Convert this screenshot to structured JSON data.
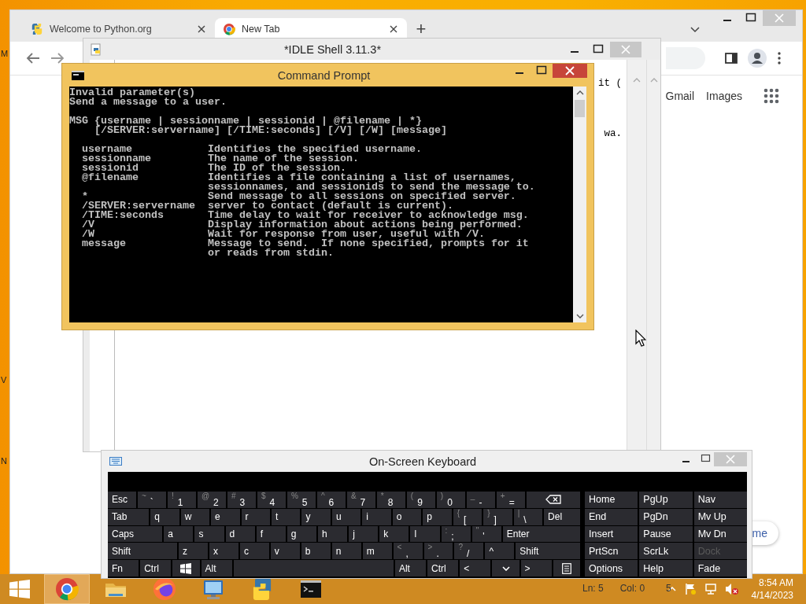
{
  "desktop": {
    "icon_labels": [
      "M",
      "V",
      "N"
    ]
  },
  "browser": {
    "tabs": [
      {
        "title": "Welcome to Python.org",
        "kind": "python",
        "selected": false
      },
      {
        "title": "New Tab",
        "kind": "chrome",
        "selected": true
      }
    ],
    "new_tab_label": "+",
    "header_links": [
      "Gmail",
      "Images"
    ],
    "corner_button": "me"
  },
  "idle": {
    "title": "*IDLE Shell 3.11.3*",
    "visible_text": [
      "it (",
      "wa."
    ],
    "status": [
      "Ln: 5",
      "Col: 0",
      "5"
    ]
  },
  "console": {
    "title": "Command Prompt",
    "blocks": [
      [
        "Invalid parameter(s)",
        "Send a message to a user."
      ],
      [
        "MSG {username | sessionname | sessionid | @filename | *}",
        "    [/SERVER:servername] [/TIME:seconds] [/V] [/W] [message]"
      ],
      [
        "  username            Identifies the specified username.",
        "  sessionname         The name of the session.",
        "  sessionid           The ID of the session.",
        "  @filename           Identifies a file containing a list of usernames,",
        "                      sessionnames, and sessionids to send the message to.",
        "  *                   Send message to all sessions on specified server.",
        "  /SERVER:servername  server to contact (default is current).",
        "  /TIME:seconds       Time delay to wait for receiver to acknowledge msg.",
        "  /V                  Display information about actions being performed.",
        "  /W                  Wait for response from user, useful with /V.",
        "  message             Message to send.  If none specified, prompts for it",
        "                      or reads from stdin."
      ]
    ]
  },
  "keyboard": {
    "title": "On-Screen Keyboard",
    "key_lines": [
      {
        "keys": [
          {
            "kind": "key",
            "label": "Esc"
          },
          {
            "kind": "key",
            "label": "`",
            "shift": "~"
          },
          {
            "kind": "key",
            "label": "1",
            "shift": "!"
          },
          {
            "kind": "key",
            "label": "2",
            "shift": "@"
          },
          {
            "kind": "key",
            "label": "3",
            "shift": "#"
          },
          {
            "kind": "key",
            "label": "4",
            "shift": "$"
          },
          {
            "kind": "key",
            "label": "5",
            "shift": "%"
          },
          {
            "kind": "key",
            "label": "6",
            "shift": "^"
          },
          {
            "kind": "key",
            "label": "7",
            "shift": "&"
          },
          {
            "kind": "key",
            "label": "8",
            "shift": "*"
          },
          {
            "kind": "key",
            "label": "9",
            "shift": "("
          },
          {
            "kind": "key",
            "label": "0",
            "shift": ")"
          },
          {
            "kind": "key",
            "label": "-",
            "shift": "_"
          },
          {
            "kind": "key",
            "label": "=",
            "shift": "+"
          },
          {
            "kind": "backspace"
          }
        ]
      },
      {
        "keys": [
          {
            "kind": "key",
            "label": "Tab"
          },
          {
            "kind": "key",
            "label": "q"
          },
          {
            "kind": "key",
            "label": "w"
          },
          {
            "kind": "key",
            "label": "e"
          },
          {
            "kind": "key",
            "label": "r"
          },
          {
            "kind": "key",
            "label": "t"
          },
          {
            "kind": "key",
            "label": "y"
          },
          {
            "kind": "key",
            "label": "u"
          },
          {
            "kind": "key",
            "label": "i"
          },
          {
            "kind": "key",
            "label": "o"
          },
          {
            "kind": "key",
            "label": "p"
          },
          {
            "kind": "key",
            "label": "[",
            "shift": "{"
          },
          {
            "kind": "key",
            "label": "]",
            "shift": "}"
          },
          {
            "kind": "key",
            "label": "\\",
            "shift": "|"
          },
          {
            "kind": "key",
            "label": "Del"
          }
        ]
      },
      {
        "keys": [
          {
            "kind": "key",
            "label": "Caps"
          },
          {
            "kind": "key",
            "label": "a"
          },
          {
            "kind": "key",
            "label": "s"
          },
          {
            "kind": "key",
            "label": "d"
          },
          {
            "kind": "key",
            "label": "f"
          },
          {
            "kind": "key",
            "label": "g"
          },
          {
            "kind": "key",
            "label": "h"
          },
          {
            "kind": "key",
            "label": "j"
          },
          {
            "kind": "key",
            "label": "k"
          },
          {
            "kind": "key",
            "label": "l"
          },
          {
            "kind": "key",
            "label": ";",
            "shift": ":"
          },
          {
            "kind": "key",
            "label": "'",
            "shift": "\""
          },
          {
            "kind": "key",
            "label": "Enter"
          }
        ]
      },
      {
        "keys": [
          {
            "kind": "key",
            "label": "Shift"
          },
          {
            "kind": "key",
            "label": "z"
          },
          {
            "kind": "key",
            "label": "x"
          },
          {
            "kind": "key",
            "label": "c"
          },
          {
            "kind": "key",
            "label": "v"
          },
          {
            "kind": "key",
            "label": "b"
          },
          {
            "kind": "key",
            "label": "n"
          },
          {
            "kind": "key",
            "label": "m"
          },
          {
            "kind": "key",
            "label": ",",
            "shift": "<"
          },
          {
            "kind": "key",
            "label": ".",
            "shift": ">"
          },
          {
            "kind": "key",
            "label": "/",
            "shift": "?"
          },
          {
            "kind": "key",
            "label": "^"
          },
          {
            "kind": "key",
            "label": "Shift"
          }
        ]
      },
      {
        "keys": [
          {
            "kind": "key",
            "label": "Fn"
          },
          {
            "kind": "key",
            "label": "Ctrl"
          },
          {
            "kind": "windows"
          },
          {
            "kind": "key",
            "label": "Alt"
          },
          {
            "kind": "space"
          },
          {
            "kind": "key",
            "label": "Alt"
          },
          {
            "kind": "key",
            "label": "Ctrl"
          },
          {
            "kind": "key",
            "label": "<"
          },
          {
            "kind": "down"
          },
          {
            "kind": "key",
            "label": ">"
          },
          {
            "kind": "menu"
          }
        ]
      }
    ],
    "nav_rows": [
      [
        {
          "label": "Home",
          "disabled": false
        },
        {
          "label": "PgUp",
          "disabled": false
        },
        {
          "label": "Nav",
          "disabled": false
        }
      ],
      [
        {
          "label": "End",
          "disabled": false
        },
        {
          "label": "PgDn",
          "disabled": false
        },
        {
          "label": "Mv Up",
          "disabled": false
        }
      ],
      [
        {
          "label": "Insert",
          "disabled": false
        },
        {
          "label": "Pause",
          "disabled": false
        },
        {
          "label": "Mv Dn",
          "disabled": false
        }
      ],
      [
        {
          "label": "PrtScn",
          "disabled": false
        },
        {
          "label": "ScrLk",
          "disabled": false
        },
        {
          "label": "Dock",
          "disabled": true
        }
      ],
      [
        {
          "label": "Options",
          "disabled": false
        },
        {
          "label": "Help",
          "disabled": false
        },
        {
          "label": "Fade",
          "disabled": false
        }
      ]
    ]
  },
  "taskbar": {
    "apps": [
      {
        "kind": "chrome",
        "selected": true
      },
      {
        "kind": "folder",
        "selected": false
      },
      {
        "kind": "firefox",
        "selected": false
      },
      {
        "kind": "remote",
        "selected": false
      },
      {
        "kind": "python",
        "selected": false
      },
      {
        "kind": "console",
        "selected": false
      }
    ],
    "time": "8:54 AM",
    "date": "4/14/2023"
  }
}
